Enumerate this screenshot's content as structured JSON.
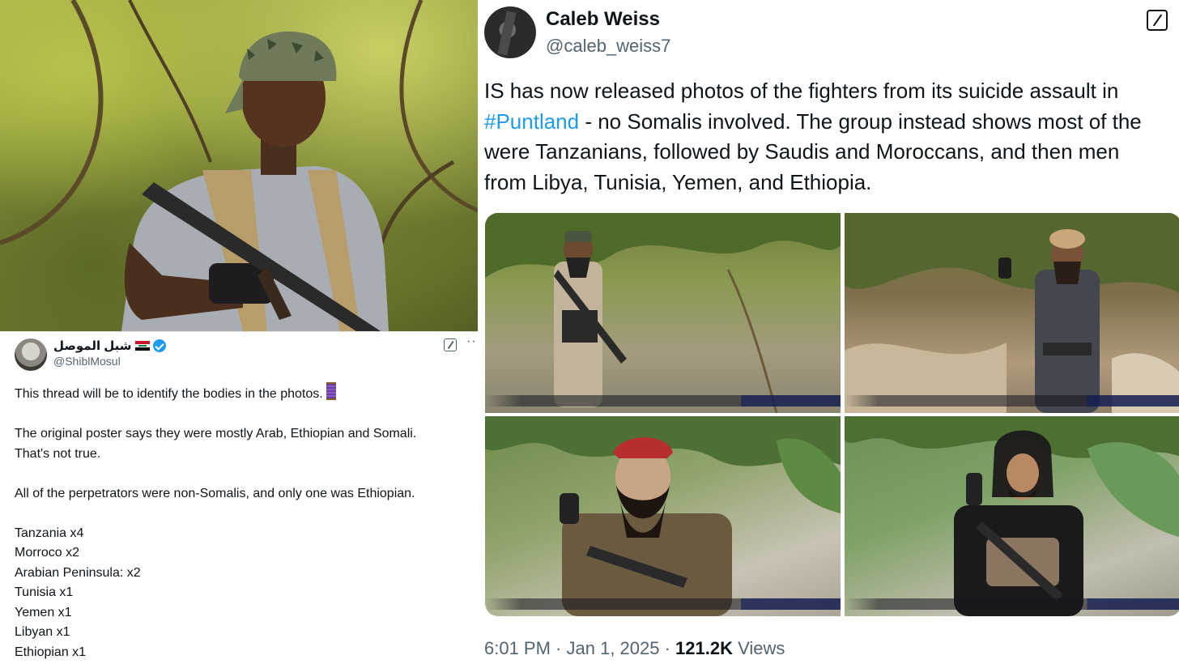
{
  "left_tweet": {
    "display_name": "شبل الموصل",
    "handle": "@ShiblMosul",
    "more_label": "···",
    "lines": [
      "This thread will be to identify the bodies in the photos.",
      "",
      "The original poster says they were mostly Arab, Ethiopian and Somali.",
      "That's not true.",
      "",
      "All of the perpetrators were non-Somalis, and only one was Ethiopian.",
      "",
      "Tanzania x4",
      "Morroco x2",
      "Arabian Peninsula: x2",
      "Tunisia x1",
      "Yemen x1",
      "Libyan x1",
      "Ethiopian x1"
    ]
  },
  "main_tweet": {
    "display_name": "Caleb Weiss",
    "handle": "@caleb_weiss7",
    "line1": "IS has now released photos of the fighters from its suicide assault in",
    "hashtag": "#Puntland",
    "line2_rest": " - no Somalis involved. The group instead shows most of the",
    "line3": "were Tanzanians, followed by Saudis and Moroccans, and then men",
    "line4": "from Libya, Tunisia, Yemen, and Ethiopia.",
    "time": "6:01 PM",
    "sep1": " · ",
    "date": "Jan 1, 2025",
    "sep2": " · ",
    "views_count": "121.2K",
    "views_label": " Views"
  },
  "colors": {
    "link": "#1d9bf0",
    "text": "#0f1419",
    "secondary": "#536471",
    "verified": "#1d9bf0"
  }
}
